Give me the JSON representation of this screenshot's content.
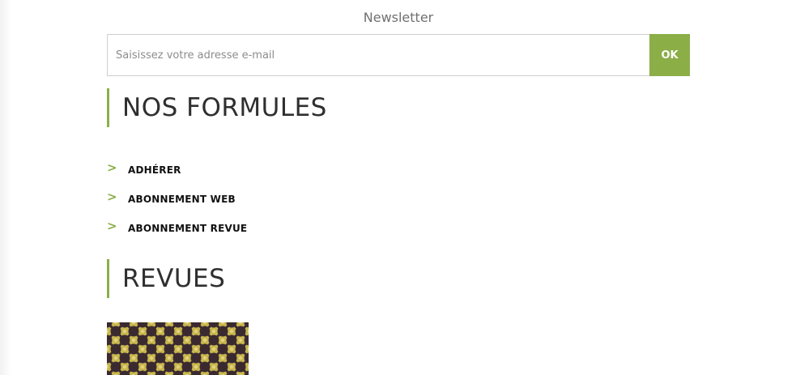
{
  "newsletter": {
    "title": "Newsletter",
    "email_placeholder": "Saisissez votre adresse e-mail",
    "email_value": "",
    "submit_label": "OK"
  },
  "formules": {
    "heading": "NOS FORMULES",
    "items": [
      {
        "label": "ADHÉRER",
        "icon": "chevron-right-icon"
      },
      {
        "label": "ABONNEMENT WEB",
        "icon": "chevron-right-icon"
      },
      {
        "label": "ABONNEMENT REVUE",
        "icon": "chevron-right-icon"
      }
    ]
  },
  "revues": {
    "heading": "REVUES",
    "cover_icon": "magazine-cover-pattern"
  },
  "colors": {
    "accent": "#8bae47",
    "heading_text": "#2f2f2f",
    "pattern_gold": "#c8b64e",
    "pattern_dark": "#3a2a30"
  }
}
